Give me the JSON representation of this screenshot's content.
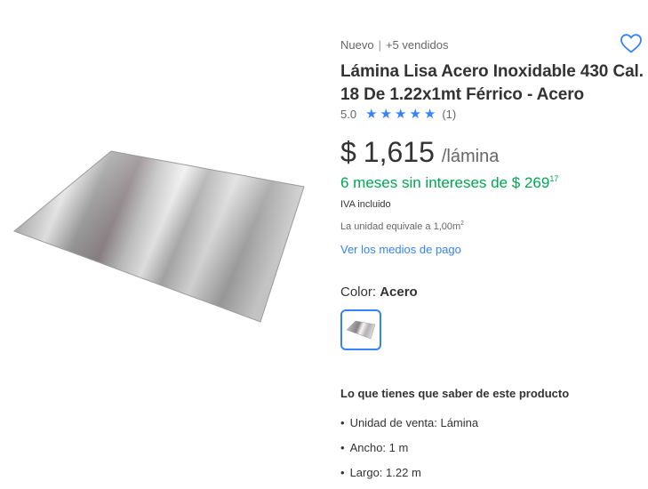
{
  "product": {
    "condition": "Nuevo",
    "separator": "|",
    "sold": "+5 vendidos",
    "title": "Lámina Lisa Acero Inoxidable 430 Cal. 18 De 1.22x1mt Férrico - Acero",
    "rating": {
      "value": "5.0",
      "stars": 5,
      "count": "(1)"
    },
    "price": {
      "currency": "$",
      "amount": "1,615",
      "unit": "/lámina"
    },
    "installments": {
      "text": "6 meses sin intereses de $ 269",
      "cents": "17"
    },
    "tax_note": "IVA incluido",
    "unit_equivalence": {
      "text": "La unidad equivale a 1,00m",
      "sup": "2"
    },
    "payment_link": "Ver los medios de pago",
    "color": {
      "label": "Color:",
      "value": "Acero"
    },
    "features_title": "Lo que tienes que saber de este producto",
    "features": [
      "Unidad de venta: Lámina",
      "Ancho: 1 m",
      "Largo: 1.22 m"
    ]
  },
  "icons": {
    "favorite": "heart-outline-icon",
    "rating_star": "star-icon"
  },
  "colors": {
    "accent_blue": "#3483fa",
    "installments_green": "#00a650",
    "text_primary": "#333333",
    "text_secondary": "#666666"
  }
}
